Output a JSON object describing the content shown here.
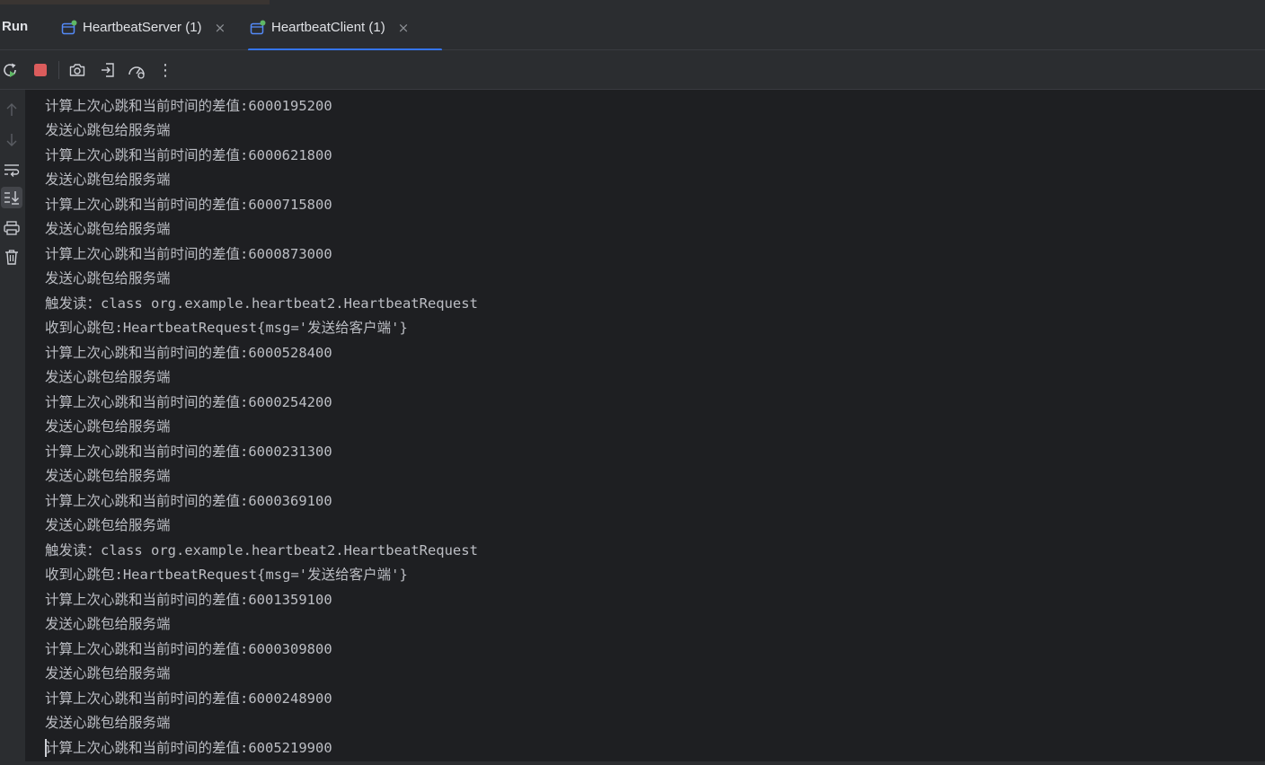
{
  "header": {
    "run_label": "Run",
    "tabs": [
      {
        "label": "HeartbeatServer (1)",
        "close": "×"
      },
      {
        "label": "HeartbeatClient (1)",
        "close": "×"
      }
    ]
  },
  "toolbar": {
    "buttons": [
      "rerun-icon",
      "stop-icon",
      "camera-icon",
      "exit-icon",
      "performance-icon",
      "more-icon"
    ],
    "more_label": "⋮"
  },
  "sidebar": {
    "buttons": [
      "arrow-up-icon",
      "arrow-down-icon",
      "soft-wrap-icon",
      "scroll-to-end-icon",
      "print-icon",
      "trash-icon"
    ]
  },
  "colors": {
    "accent": "#3574f0",
    "stop_red": "#db5c5c",
    "run_green": "#5fb865",
    "text": "#bcbec4"
  },
  "console": {
    "lines": [
      "计算上次心跳和当前时间的差值:6000195200",
      "发送心跳包给服务端",
      "计算上次心跳和当前时间的差值:6000621800",
      "发送心跳包给服务端",
      "计算上次心跳和当前时间的差值:6000715800",
      "发送心跳包给服务端",
      "计算上次心跳和当前时间的差值:6000873000",
      "发送心跳包给服务端",
      "触发读：class org.example.heartbeat2.HeartbeatRequest",
      "收到心跳包:HeartbeatRequest{msg='发送给客户端'}",
      "计算上次心跳和当前时间的差值:6000528400",
      "发送心跳包给服务端",
      "计算上次心跳和当前时间的差值:6000254200",
      "发送心跳包给服务端",
      "计算上次心跳和当前时间的差值:6000231300",
      "发送心跳包给服务端",
      "计算上次心跳和当前时间的差值:6000369100",
      "发送心跳包给服务端",
      "触发读：class org.example.heartbeat2.HeartbeatRequest",
      "收到心跳包:HeartbeatRequest{msg='发送给客户端'}",
      "计算上次心跳和当前时间的差值:6001359100",
      "发送心跳包给服务端",
      "计算上次心跳和当前时间的差值:6000309800",
      "发送心跳包给服务端",
      "计算上次心跳和当前时间的差值:6000248900",
      "发送心跳包给服务端",
      "计算上次心跳和当前时间的差值:6005219900"
    ]
  }
}
